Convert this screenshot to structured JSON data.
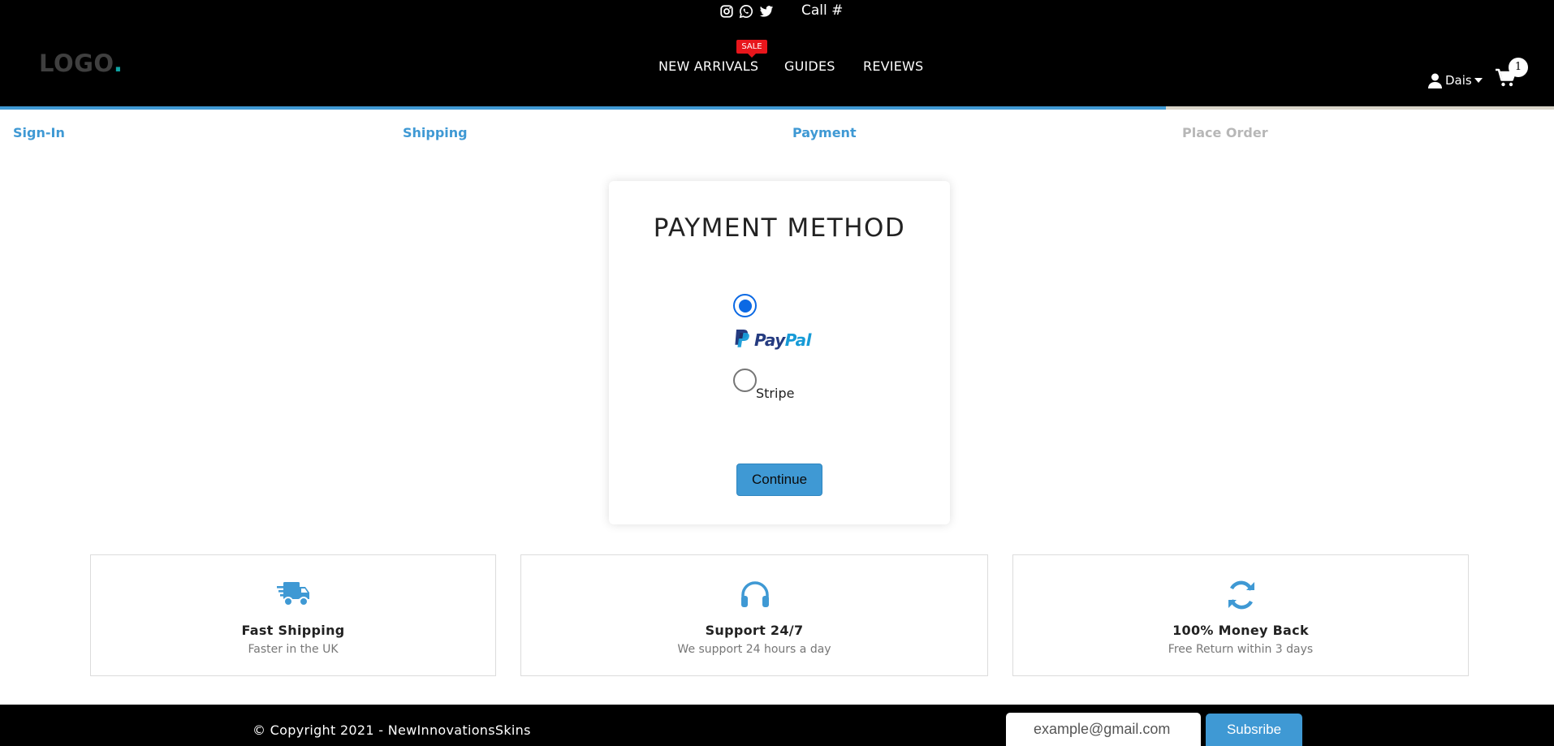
{
  "header": {
    "social": [
      {
        "name": "instagram-icon"
      },
      {
        "name": "whatsapp-icon"
      },
      {
        "name": "twitter-icon"
      }
    ],
    "call_label": "Call #",
    "logo_text": "LOGO",
    "logo_dot": ".",
    "nav": [
      {
        "label": "NEW ARRIVALS",
        "badge": "SALE"
      },
      {
        "label": "GUIDES"
      },
      {
        "label": "REVIEWS"
      }
    ],
    "user_name": "Dais",
    "cart_count": "1",
    "colors": {
      "background": "#000000",
      "accent": "#0fa3a3",
      "badge": "#e8161c"
    }
  },
  "checkout": {
    "progress_fraction": 0.75,
    "steps": [
      {
        "label": "Sign-In",
        "state": "done"
      },
      {
        "label": "Shipping",
        "state": "done"
      },
      {
        "label": "Payment",
        "state": "done"
      },
      {
        "label": "Place Order",
        "state": "todo"
      }
    ],
    "accent_color": "#3f99d4"
  },
  "payment": {
    "title": "PAYMENT METHOD",
    "options": [
      {
        "label": "PayPal",
        "logo_part1": "Pay",
        "logo_part2": "Pal",
        "checked": true
      },
      {
        "label": "Stripe",
        "checked": false
      }
    ],
    "continue_label": "Continue"
  },
  "features": [
    {
      "icon": "truck-icon",
      "title": "Fast Shipping",
      "subtitle": "Faster in the UK"
    },
    {
      "icon": "headphones-icon",
      "title": "Support 24/7",
      "subtitle": "We support 24 hours a day"
    },
    {
      "icon": "refresh-icon",
      "title": "100% Money Back",
      "subtitle": "Free Return within 3 days"
    }
  ],
  "footer": {
    "copyright": "© Copyright 2021 - NewInnovationsSkins",
    "email_placeholder": "example@gmail.com",
    "subscribe_label": "Subsribe"
  }
}
